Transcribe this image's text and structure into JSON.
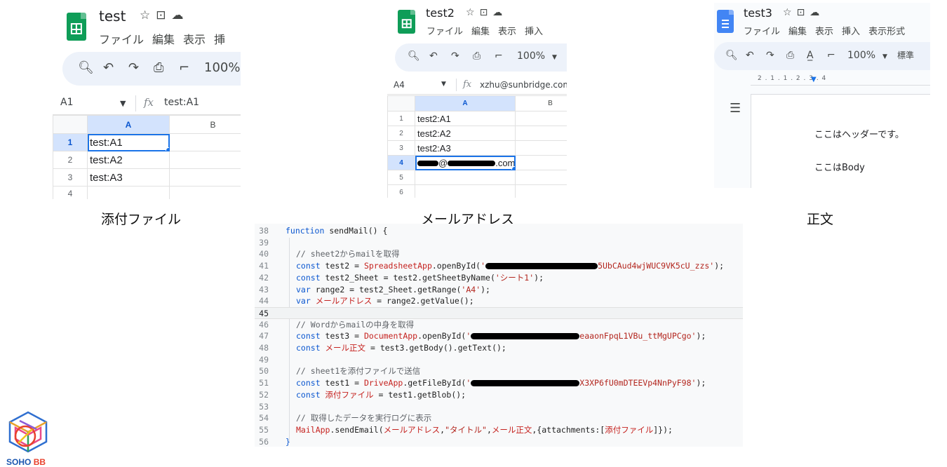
{
  "panel1": {
    "title": "test",
    "menu": [
      "ファイル",
      "編集",
      "表示",
      "挿"
    ],
    "zoom": "100%",
    "cell_ref": "A1",
    "formula": "test:A1",
    "columns": [
      "A",
      "B"
    ],
    "rows": [
      {
        "num": "1",
        "a": "test:A1"
      },
      {
        "num": "2",
        "a": "test:A2"
      },
      {
        "num": "3",
        "a": "test:A3"
      },
      {
        "num": "4",
        "a": ""
      }
    ],
    "caption": "添付ファイル"
  },
  "panel2": {
    "title": "test2",
    "menu": [
      "ファイル",
      "編集",
      "表示",
      "挿入"
    ],
    "zoom": "100%",
    "cell_ref": "A4",
    "formula": "xzhu@sunbridge.com",
    "columns": [
      "A",
      "B"
    ],
    "rows": [
      {
        "num": "1",
        "a": "test2:A1"
      },
      {
        "num": "2",
        "a": "test2:A2"
      },
      {
        "num": "3",
        "a": "test2:A3"
      },
      {
        "num": "4",
        "a_tail": ".com"
      },
      {
        "num": "5",
        "a": ""
      },
      {
        "num": "6",
        "a": ""
      }
    ],
    "caption": "メールアドレス"
  },
  "panel3": {
    "title": "test3",
    "menu": [
      "ファイル",
      "編集",
      "表示",
      "挿入",
      "表示形式"
    ],
    "zoom": "100%",
    "style": "標準",
    "ruler": "2 . 1 . 1 . 2 . 3 . 4",
    "header_text": "ここはヘッダーです。",
    "body_text": "ここはBody",
    "caption": "正文"
  },
  "code": {
    "lines": [
      {
        "n": "38",
        "indent": 0,
        "parts": [
          [
            "kw",
            "function"
          ],
          [
            "fn",
            " sendMail() {"
          ]
        ]
      },
      {
        "n": "39",
        "indent": 0,
        "parts": []
      },
      {
        "n": "40",
        "indent": 1,
        "parts": [
          [
            "cm",
            "// sheet2からmailを取得"
          ]
        ]
      },
      {
        "n": "41",
        "indent": 1,
        "parts": [
          [
            "kw",
            "const"
          ],
          [
            "fn",
            " test2 = "
          ],
          [
            "nm",
            "SpreadsheetApp"
          ],
          [
            "fn",
            ".openById("
          ],
          [
            "st",
            "'"
          ],
          [
            "redact",
            "160"
          ],
          [
            "st",
            "5UbCAud4wjWUC9VK5cU_zzs'"
          ],
          [
            "fn",
            ");"
          ]
        ]
      },
      {
        "n": "42",
        "indent": 1,
        "parts": [
          [
            "kw",
            "const"
          ],
          [
            "fn",
            " test2_Sheet = test2.getSheetByName("
          ],
          [
            "st",
            "'シート1'"
          ],
          [
            "fn",
            ");"
          ]
        ]
      },
      {
        "n": "43",
        "indent": 1,
        "parts": [
          [
            "kw",
            "var"
          ],
          [
            "fn",
            " range2 = test2_Sheet.getRange("
          ],
          [
            "st",
            "'A4'"
          ],
          [
            "fn",
            ");"
          ]
        ]
      },
      {
        "n": "44",
        "indent": 1,
        "parts": [
          [
            "kw",
            "var"
          ],
          [
            "nm",
            " メールアドレス"
          ],
          [
            "fn",
            " = range2.getValue();"
          ]
        ]
      },
      {
        "n": "45",
        "indent": 0,
        "cur": true,
        "parts": []
      },
      {
        "n": "46",
        "indent": 1,
        "parts": [
          [
            "cm",
            "// Wordからmailの中身を取得"
          ]
        ]
      },
      {
        "n": "47",
        "indent": 1,
        "parts": [
          [
            "kw",
            "const"
          ],
          [
            "fn",
            " test3 = "
          ],
          [
            "nm",
            "DocumentApp"
          ],
          [
            "fn",
            ".openById("
          ],
          [
            "st",
            "'"
          ],
          [
            "redact",
            "155"
          ],
          [
            "st",
            "eaaonFpqL1VBu_ttMgUPCgo'"
          ],
          [
            "fn",
            ");"
          ]
        ]
      },
      {
        "n": "48",
        "indent": 1,
        "parts": [
          [
            "kw",
            "const"
          ],
          [
            "nm",
            " メール正文"
          ],
          [
            "fn",
            " = test3.getBody().getText();"
          ]
        ]
      },
      {
        "n": "49",
        "indent": 0,
        "parts": []
      },
      {
        "n": "50",
        "indent": 1,
        "parts": [
          [
            "cm",
            "// sheet1を添付ファイルで送信"
          ]
        ]
      },
      {
        "n": "51",
        "indent": 1,
        "parts": [
          [
            "kw",
            "const"
          ],
          [
            "fn",
            " test1 = "
          ],
          [
            "nm",
            "DriveApp"
          ],
          [
            "fn",
            ".getFileById("
          ],
          [
            "st",
            "'"
          ],
          [
            "redact",
            "155"
          ],
          [
            "st",
            "X3XP6fU0mDTEEVp4NnPyF98'"
          ],
          [
            "fn",
            ");"
          ]
        ]
      },
      {
        "n": "52",
        "indent": 1,
        "parts": [
          [
            "kw",
            "const"
          ],
          [
            "nm",
            " 添付ファイル"
          ],
          [
            "fn",
            " = test1.getBlob();"
          ]
        ]
      },
      {
        "n": "53",
        "indent": 0,
        "parts": []
      },
      {
        "n": "54",
        "indent": 1,
        "parts": [
          [
            "cm",
            "// 取得したデータを実行ログに表示"
          ]
        ]
      },
      {
        "n": "55",
        "indent": 1,
        "parts": [
          [
            "nm",
            "MailApp"
          ],
          [
            "fn",
            ".sendEmail("
          ],
          [
            "nm",
            "メールアドレス"
          ],
          [
            "fn",
            ","
          ],
          [
            "st",
            "\"タイトル\""
          ],
          [
            "fn",
            ","
          ],
          [
            "nm",
            "メール正文"
          ],
          [
            "fn",
            ",{attachments:["
          ],
          [
            "nm",
            "添付ファイル"
          ],
          [
            "fn",
            "]});"
          ]
        ]
      },
      {
        "n": "56",
        "indent": 0,
        "parts": [
          [
            "kw",
            "}"
          ]
        ]
      }
    ]
  },
  "logo": {
    "text1": "SOHO",
    "text2": "BB"
  },
  "icons": {
    "star": "star-icon",
    "move": "move-to-folder-icon",
    "cloud": "cloud-status-icon",
    "search": "search-icon",
    "undo": "undo-icon",
    "redo": "redo-icon",
    "print": "print-icon",
    "paint": "paint-format-icon",
    "spell": "spellcheck-icon",
    "outline": "outline-icon",
    "fx": "function-icon"
  },
  "colors": {
    "sheets": "#0f9d58",
    "docs": "#4285f4",
    "selection": "#1a73e8"
  }
}
